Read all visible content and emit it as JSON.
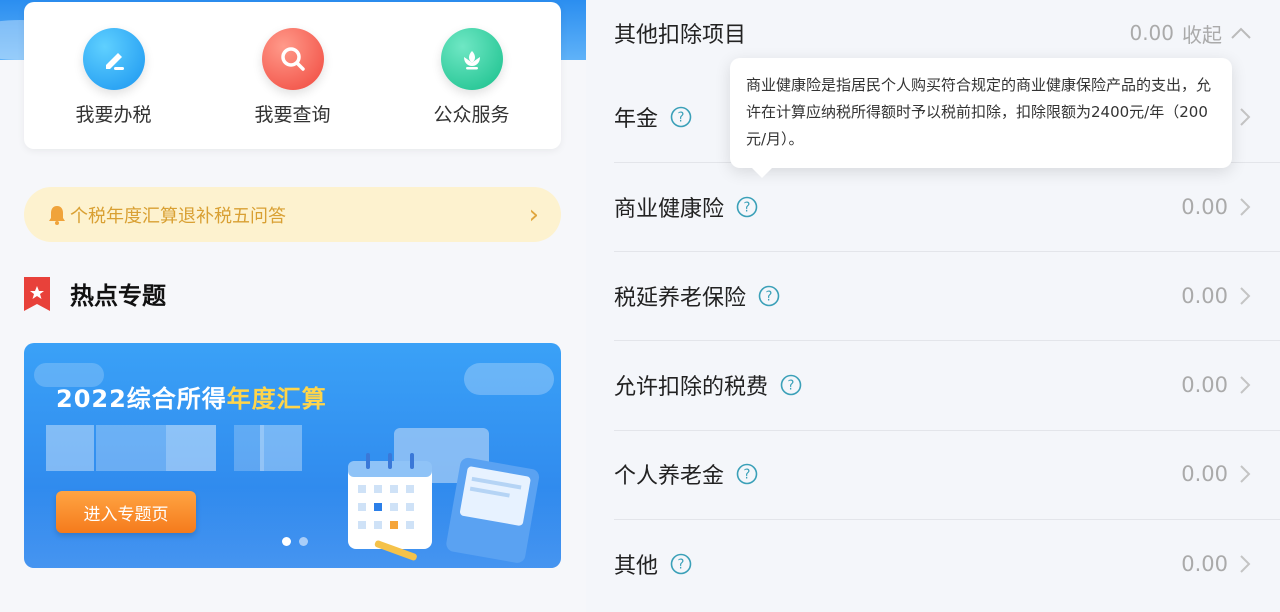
{
  "quick_actions": [
    {
      "label": "我要办税",
      "icon": "edit-icon"
    },
    {
      "label": "我要查询",
      "icon": "search-icon"
    },
    {
      "label": "公众服务",
      "icon": "flower-icon"
    }
  ],
  "notice": {
    "text": "个税年度汇算退补税五问答"
  },
  "section": {
    "title": "热点专题"
  },
  "banner": {
    "title_prefix": "2022综合所得",
    "title_highlight": "年度汇算",
    "button": "进入专题页",
    "slides": 2,
    "active_slide": 1
  },
  "deductions": {
    "header": {
      "label": "其他扣除项目",
      "value": "0.00",
      "toggle": "收起"
    },
    "tooltip": "商业健康险是指居民个人购买符合规定的商业健康保险产品的支出，允许在计算应纳税所得额时予以税前扣除，扣除限额为2400元/年（200元/月）。",
    "items": [
      {
        "label": "年金",
        "value": ""
      },
      {
        "label": "商业健康险",
        "value": "0.00"
      },
      {
        "label": "税延养老保险",
        "value": "0.00"
      },
      {
        "label": "允许扣除的税费",
        "value": "0.00"
      },
      {
        "label": "个人养老金",
        "value": "0.00"
      },
      {
        "label": "其他",
        "value": "0.00"
      }
    ]
  },
  "colors": {
    "accent_blue": "#2b8ef0",
    "help_icon": "#3aa0b8",
    "notice_bg": "#fdf2cf",
    "notice_text": "#d9a033",
    "banner_button": "#f57b1c"
  }
}
